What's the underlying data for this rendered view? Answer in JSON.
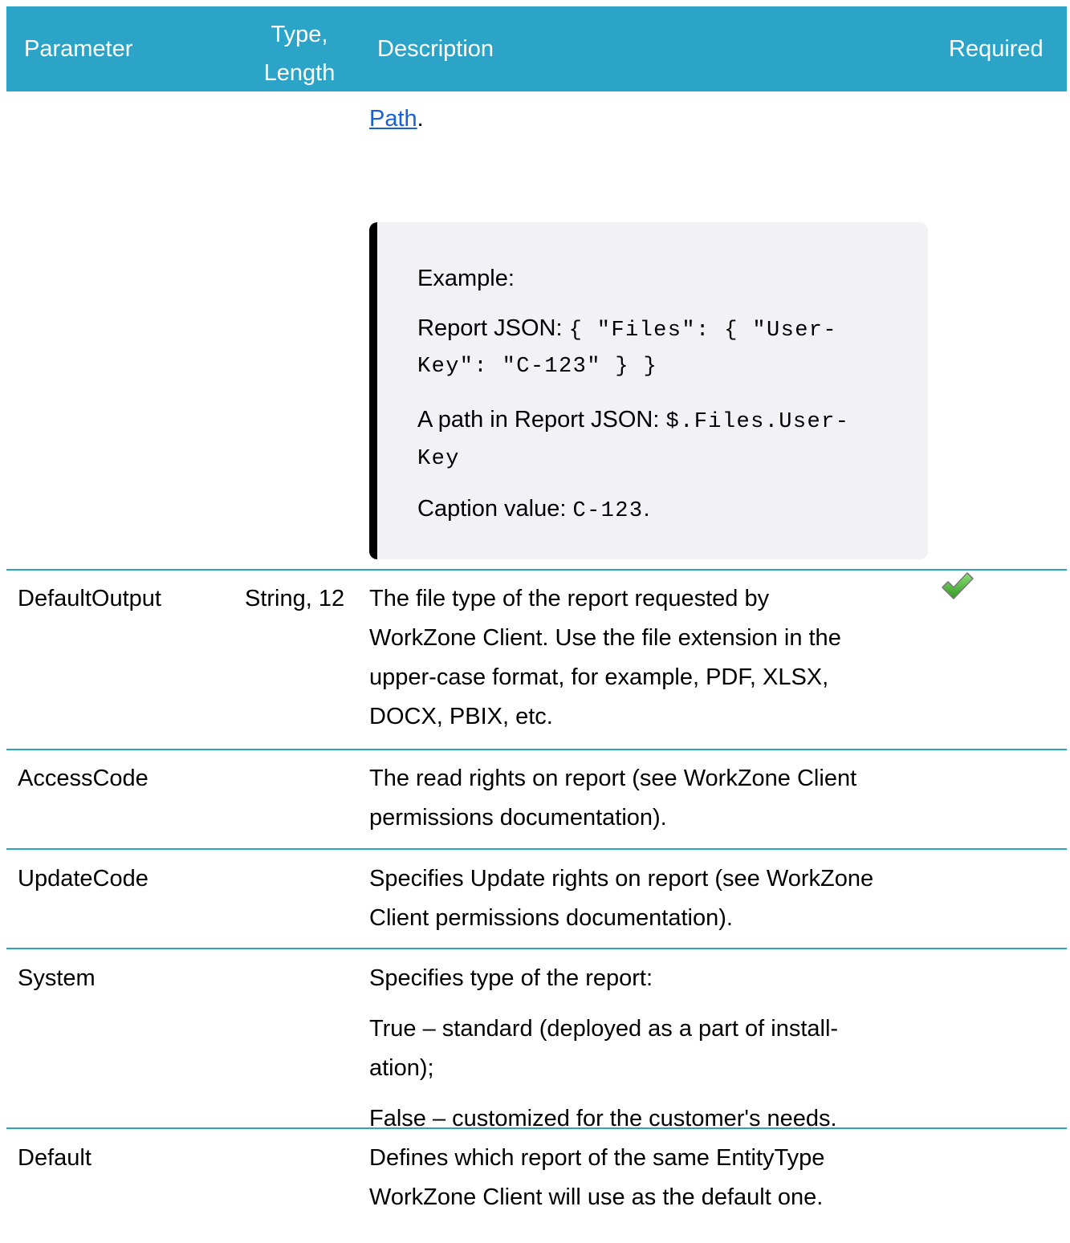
{
  "header": {
    "parameter": "Parameter",
    "type_line1": "Type,",
    "type_line2": "Length",
    "description": "Description",
    "required": "Required"
  },
  "continuation": {
    "link_text": "Path",
    "trailing": "."
  },
  "example": {
    "title": "Example",
    "title_colon": ":",
    "line1_label": "Report JSON: ",
    "line1_code_a": "{ \"Files\": { \"User-",
    "line1_code_b": "Key\": \"C-123\" } }",
    "line2_label": "A path in Report JSON: ",
    "line2_code_a": "$.Files.User-",
    "line2_code_b": "Key",
    "line3_label": "Caption value: ",
    "line3_code": "C-123",
    "line3_tail": "."
  },
  "rows": [
    {
      "parameter": "DefaultOutput",
      "type": "String, 12",
      "description_lines": [
        "The file type of the report requested by",
        "WorkZone Client. Use the file extension in the",
        "upper-case format, for example, PDF, XLSX,",
        "DOCX, PBIX, etc."
      ],
      "required_icon": "green-checkmark-icon"
    },
    {
      "parameter": "AccessCode",
      "type": "",
      "description_lines": [
        "The read rights on report (see WorkZone Client",
        "permissions documentation)."
      ]
    },
    {
      "parameter": "UpdateCode",
      "type": "",
      "description_lines": [
        "Specifies Update rights on report (see WorkZone",
        "Client permissions documentation)."
      ]
    },
    {
      "parameter": "System",
      "type": "",
      "description_p1": "Specifies type of the report:",
      "description_p2_lines": [
        "True – standard (deployed as a part of install-",
        "ation);"
      ],
      "description_p3": "False – customized for the customer's needs."
    },
    {
      "parameter": "Default",
      "type": "",
      "description_lines": [
        "Defines which report of the same EntityType",
        "WorkZone Client will use as the default one."
      ]
    }
  ],
  "colors": {
    "header_bg": "#2ba4c8",
    "link": "#1a5fd6",
    "example_bg": "#f2f2f4",
    "check_green": "#3cae2b"
  }
}
